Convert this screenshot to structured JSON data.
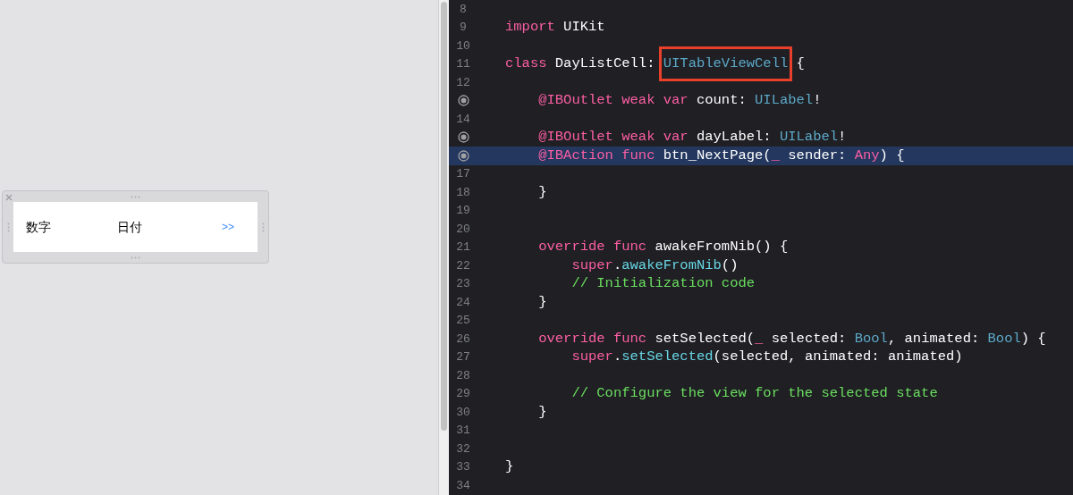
{
  "canvas": {
    "cell": {
      "labels": [
        {
          "text": "数字",
          "kind": "label"
        },
        {
          "text": "日付",
          "kind": "label"
        },
        {
          "text": ">>",
          "kind": "button"
        }
      ]
    }
  },
  "editor": {
    "lines": [
      {
        "number": "8",
        "outlet": false,
        "selected": false
      },
      {
        "number": "9",
        "outlet": false,
        "selected": false,
        "tokens": [
          {
            "text": "import",
            "kind": "keyword"
          },
          {
            "text": " UIKit",
            "kind": "plain"
          }
        ]
      },
      {
        "number": "10",
        "outlet": false,
        "selected": false
      },
      {
        "number": "11",
        "outlet": false,
        "selected": false,
        "tokens": [
          {
            "text": "class",
            "kind": "keyword"
          },
          {
            "text": " DayListCell: ",
            "kind": "plain"
          },
          {
            "text": "UITableViewCell",
            "kind": "type",
            "highlighted": true
          },
          {
            "text": " {",
            "kind": "plain"
          }
        ]
      },
      {
        "number": "12",
        "outlet": false,
        "selected": false
      },
      {
        "outlet": true,
        "selected": false,
        "tokens": [
          {
            "text": "    @IBOutlet weak var",
            "kind": "keyword"
          },
          {
            "text": " count: ",
            "kind": "plain"
          },
          {
            "text": "UILabel",
            "kind": "type"
          },
          {
            "text": "!",
            "kind": "plain"
          }
        ]
      },
      {
        "number": "14",
        "outlet": false,
        "selected": false
      },
      {
        "outlet": true,
        "selected": false,
        "tokens": [
          {
            "text": "    @IBOutlet weak var",
            "kind": "keyword"
          },
          {
            "text": " dayLabel: ",
            "kind": "plain"
          },
          {
            "text": "UILabel",
            "kind": "type"
          },
          {
            "text": "!",
            "kind": "plain"
          }
        ]
      },
      {
        "outlet": true,
        "selected": true,
        "tokens": [
          {
            "text": "    @IBAction func",
            "kind": "keyword"
          },
          {
            "text": " btn_NextPage(",
            "kind": "plain"
          },
          {
            "text": "_",
            "kind": "keyword"
          },
          {
            "text": " sender: ",
            "kind": "plain"
          },
          {
            "text": "Any",
            "kind": "keyword"
          },
          {
            "text": ") {",
            "kind": "plain"
          }
        ]
      },
      {
        "number": "17",
        "outlet": false,
        "selected": false
      },
      {
        "number": "18",
        "outlet": false,
        "selected": false,
        "tokens": [
          {
            "text": "    }",
            "kind": "plain"
          }
        ]
      },
      {
        "number": "19",
        "outlet": false,
        "selected": false
      },
      {
        "number": "20",
        "outlet": false,
        "selected": false
      },
      {
        "number": "21",
        "outlet": false,
        "selected": false,
        "tokens": [
          {
            "text": "    override func",
            "kind": "keyword"
          },
          {
            "text": " awakeFromNib() {",
            "kind": "plain"
          }
        ]
      },
      {
        "number": "22",
        "outlet": false,
        "selected": false,
        "tokens": [
          {
            "text": "        super",
            "kind": "keyword"
          },
          {
            "text": ".",
            "kind": "plain"
          },
          {
            "text": "awakeFromNib",
            "kind": "call"
          },
          {
            "text": "()",
            "kind": "plain"
          }
        ]
      },
      {
        "number": "23",
        "outlet": false,
        "selected": false,
        "tokens": [
          {
            "text": "        // Initialization code",
            "kind": "comment"
          }
        ]
      },
      {
        "number": "24",
        "outlet": false,
        "selected": false,
        "tokens": [
          {
            "text": "    }",
            "kind": "plain"
          }
        ]
      },
      {
        "number": "25",
        "outlet": false,
        "selected": false
      },
      {
        "number": "26",
        "outlet": false,
        "selected": false,
        "tokens": [
          {
            "text": "    override func",
            "kind": "keyword"
          },
          {
            "text": " setSelected(",
            "kind": "plain"
          },
          {
            "text": "_",
            "kind": "keyword"
          },
          {
            "text": " selected: ",
            "kind": "plain"
          },
          {
            "text": "Bool",
            "kind": "type"
          },
          {
            "text": ", animated: ",
            "kind": "plain"
          },
          {
            "text": "Bool",
            "kind": "type"
          },
          {
            "text": ") {",
            "kind": "plain"
          }
        ]
      },
      {
        "number": "27",
        "outlet": false,
        "selected": false,
        "tokens": [
          {
            "text": "        super",
            "kind": "keyword"
          },
          {
            "text": ".",
            "kind": "plain"
          },
          {
            "text": "setSelected",
            "kind": "call"
          },
          {
            "text": "(selected, animated: animated)",
            "kind": "plain"
          }
        ]
      },
      {
        "number": "28",
        "outlet": false,
        "selected": false
      },
      {
        "number": "29",
        "outlet": false,
        "selected": false,
        "tokens": [
          {
            "text": "        // Configure the view for the selected state",
            "kind": "comment"
          }
        ]
      },
      {
        "number": "30",
        "outlet": false,
        "selected": false,
        "tokens": [
          {
            "text": "    }",
            "kind": "plain"
          }
        ]
      },
      {
        "number": "31",
        "outlet": false,
        "selected": false
      },
      {
        "number": "32",
        "outlet": false,
        "selected": false
      },
      {
        "number": "33",
        "outlet": false,
        "selected": false,
        "tokens": [
          {
            "text": "}",
            "kind": "plain"
          }
        ]
      },
      {
        "number": "34",
        "outlet": false,
        "selected": false
      }
    ]
  }
}
